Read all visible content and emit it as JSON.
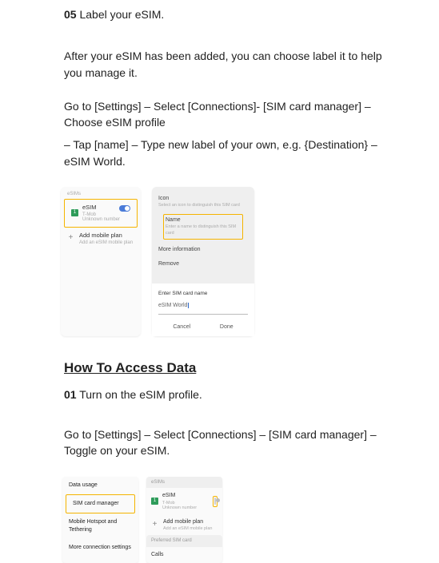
{
  "step05": {
    "num": "05",
    "title": "Label your eSIM."
  },
  "p1": "After your eSIM has been added, you can choose label it to help you manage it.",
  "p2": "Go to [Settings] – Select [Connections]- [SIM card manager] – Choose eSIM profile",
  "p3": "– Tap [name] – Type new label of your own, e.g. {Destination} – eSIM World.",
  "mock1": {
    "left": {
      "header": "eSIMs",
      "esim": "eSIM",
      "esim_sub1": "T-Mob",
      "esim_sub2": "Unknown number",
      "add": "Add mobile plan",
      "add_sub": "Add an eSIM mobile plan"
    },
    "right": {
      "iconHead": "Icon",
      "iconSub": "Select an icon to distinguish this SIM card",
      "nameHead": "Name",
      "nameSub": "Enter a name to distinguish this SIM card",
      "more": "More information",
      "remove": "Remove",
      "enter": "Enter SIM card name",
      "value": "eSIM World",
      "cancel": "Cancel",
      "done": "Done"
    }
  },
  "section2": "How To Access Data",
  "step01": {
    "num": "01",
    "title": "Turn on the eSIM profile."
  },
  "p4": "Go to [Settings] – Select [Connections] – [SIM card manager] – Toggle on your eSIM.",
  "mock2": {
    "left": {
      "r1": "Data usage",
      "r2": "SIM card manager",
      "r3": "Mobile Hotspot and Tethering",
      "r4": "More connection settings"
    },
    "right": {
      "hdr1": "eSIMs",
      "esim": "eSIM",
      "esim_sub1": "T-Mob",
      "esim_sub2": "Unknown number",
      "add": "Add mobile plan",
      "add_sub": "Add an eSIM mobile plan",
      "hdr2": "Preferred SIM card",
      "calls": "Calls"
    }
  }
}
